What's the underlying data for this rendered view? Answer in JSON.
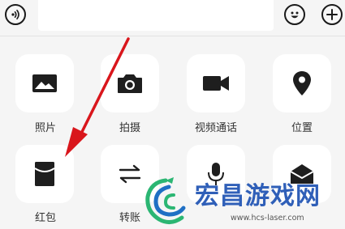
{
  "actions": [
    {
      "label": "照片",
      "icon": "image-icon"
    },
    {
      "label": "拍摄",
      "icon": "camera-icon"
    },
    {
      "label": "视频通话",
      "icon": "video-call-icon"
    },
    {
      "label": "位置",
      "icon": "location-pin-icon"
    },
    {
      "label": "红包",
      "icon": "red-packet-icon"
    },
    {
      "label": "转账",
      "icon": "transfer-icon"
    },
    {
      "label": "",
      "icon": "microphone-icon"
    },
    {
      "label": "",
      "icon": "envelope-icon"
    }
  ],
  "watermark": {
    "title": "宏昌游戏网",
    "url": "www.hcs-laser.com"
  },
  "colors": {
    "arrow": "#d9161c",
    "icon": "#1e1e1e",
    "watermark_title": "#2f5fb8",
    "watermark_logo_green": "#2bb673",
    "watermark_logo_blue": "#1f6fc4"
  }
}
